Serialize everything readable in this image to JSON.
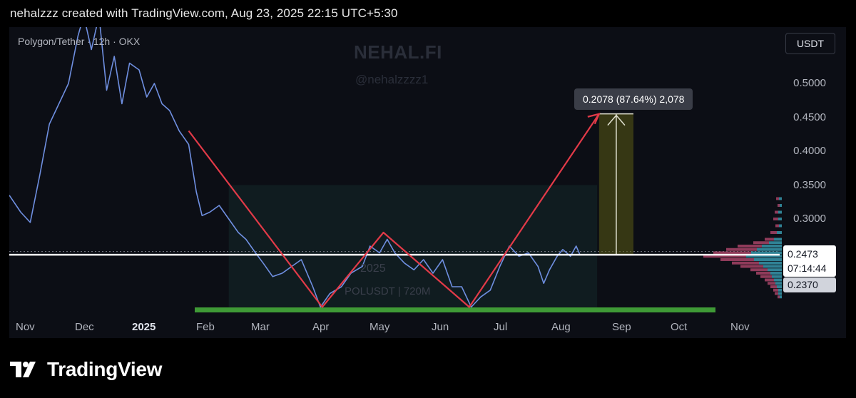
{
  "header": {
    "credit": "nehalzzz created with TradingView.com, Aug 23, 2025 22:15 UTC+5:30"
  },
  "chart": {
    "symbol_line": "Polygon/Tether · 12h · OKX",
    "currency": "USDT",
    "watermark_title": "NEHAL.FI",
    "watermark_handle": "@nehalzzzz1",
    "watermark_year": "2025",
    "watermark_symbol": "POLUSDT | 720M",
    "tooltip": "0.2078 (87.64%) 2,078",
    "last_price": "0.2473",
    "countdown": "07:14:44",
    "level_price": "0.2370"
  },
  "footer": {
    "brand": "TradingView"
  },
  "chart_data": {
    "type": "line",
    "title": "Polygon/Tether · 12h · OKX",
    "y_axis": {
      "ticks": [
        "0.5000",
        "0.4500",
        "0.4000",
        "0.3500",
        "0.3000"
      ],
      "range": [
        0.17,
        0.58
      ]
    },
    "x_axis": {
      "ticks": [
        "Nov",
        "Dec",
        "2025",
        "Feb",
        "Mar",
        "Apr",
        "May",
        "Jun",
        "Jul",
        "Aug",
        "Sep",
        "Oct",
        "Nov"
      ],
      "range": [
        "2024-10-28",
        "2025-11-30"
      ]
    },
    "series": [
      {
        "x": [
          "2024-10-28",
          "2024-11-03",
          "2024-11-08",
          "2024-11-13",
          "2024-11-18",
          "2024-11-23",
          "2024-11-28",
          "2024-12-03",
          "2024-12-06",
          "2024-12-10",
          "2024-12-14",
          "2024-12-18",
          "2024-12-22",
          "2024-12-26",
          "2024-12-30",
          "2025-01-04",
          "2025-01-08",
          "2025-01-12",
          "2025-01-16",
          "2025-01-20",
          "2025-01-25",
          "2025-01-30",
          "2025-02-03",
          "2025-02-06",
          "2025-02-10",
          "2025-02-15",
          "2025-02-20",
          "2025-02-25",
          "2025-03-01",
          "2025-03-06",
          "2025-03-10",
          "2025-03-15",
          "2025-03-20",
          "2025-03-25",
          "2025-03-30",
          "2025-04-05",
          "2025-04-09",
          "2025-04-14",
          "2025-04-20",
          "2025-04-25",
          "2025-05-01",
          "2025-05-05",
          "2025-05-10",
          "2025-05-14",
          "2025-05-18",
          "2025-05-23",
          "2025-05-28",
          "2025-06-02",
          "2025-06-07",
          "2025-06-12",
          "2025-06-17",
          "2025-06-22",
          "2025-06-27",
          "2025-07-02",
          "2025-07-07",
          "2025-07-12",
          "2025-07-17",
          "2025-07-22",
          "2025-07-27",
          "2025-08-01",
          "2025-08-04",
          "2025-08-07",
          "2025-08-11",
          "2025-08-14",
          "2025-08-18",
          "2025-08-21",
          "2025-08-23"
        ],
        "y": [
          0.335,
          0.31,
          0.295,
          0.365,
          0.44,
          0.47,
          0.5,
          0.57,
          0.6,
          0.55,
          0.6,
          0.49,
          0.54,
          0.47,
          0.53,
          0.52,
          0.48,
          0.5,
          0.47,
          0.46,
          0.43,
          0.41,
          0.34,
          0.305,
          0.31,
          0.32,
          0.3,
          0.28,
          0.27,
          0.25,
          0.235,
          0.215,
          0.22,
          0.23,
          0.24,
          0.2,
          0.17,
          0.19,
          0.2,
          0.22,
          0.23,
          0.26,
          0.25,
          0.27,
          0.25,
          0.235,
          0.225,
          0.24,
          0.22,
          0.24,
          0.2,
          0.2,
          0.17,
          0.185,
          0.195,
          0.23,
          0.26,
          0.245,
          0.25,
          0.23,
          0.205,
          0.225,
          0.245,
          0.255,
          0.245,
          0.26,
          0.247
        ]
      }
    ],
    "annotations": {
      "pattern_points": [
        [
          "2025-01-30",
          0.43
        ],
        [
          "2025-04-10",
          0.17
        ],
        [
          "2025-05-12",
          0.28
        ],
        [
          "2025-06-26",
          0.17
        ],
        [
          "2025-09-02",
          0.455
        ]
      ],
      "support_level": 0.17,
      "horizontal_level": 0.2473,
      "target_box": {
        "from": "2025-09-02",
        "to": "2025-09-20",
        "bottom": 0.2473,
        "top": 0.4551
      },
      "range_box": {
        "from": "2025-02-20",
        "to": "2025-09-01",
        "bottom": 0.17,
        "top": 0.35
      },
      "target_label": "0.2078 (87.64%) 2,078"
    }
  }
}
